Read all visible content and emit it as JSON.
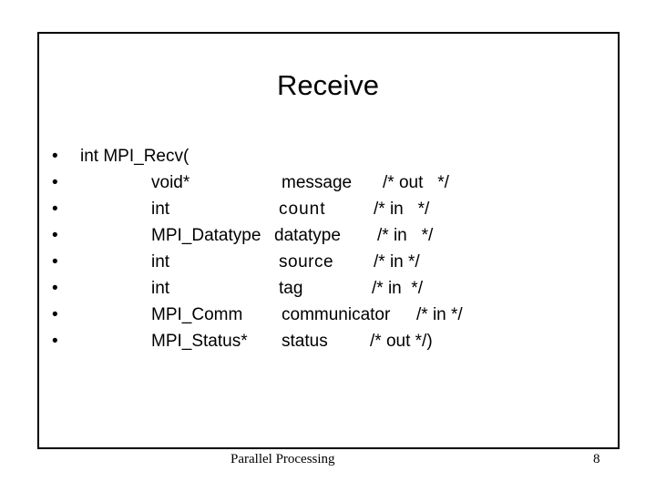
{
  "slide": {
    "title": "Receive",
    "lines": [
      {
        "bullet": "•",
        "head": "int MPI_Recv(",
        "type": "",
        "name": "",
        "comment": ""
      },
      {
        "bullet": "•",
        "head": "",
        "type": "void*",
        "name": "message",
        "comment": "/* out   */"
      },
      {
        "bullet": "•",
        "head": "",
        "type": "int",
        "name": "count",
        "comment": "/* in   */"
      },
      {
        "bullet": "•",
        "head": "",
        "type": "MPI_Datatype",
        "name": "datatype",
        "comment": "/* in   */"
      },
      {
        "bullet": "•",
        "head": "",
        "type": "int",
        "name": "source",
        "comment": "/* in */"
      },
      {
        "bullet": "•",
        "head": "",
        "type": "int",
        "name": "tag",
        "comment": "/* in  */"
      },
      {
        "bullet": "•",
        "head": "",
        "type": "MPI_Comm",
        "name": "communicator",
        "comment": "/* in */"
      },
      {
        "bullet": "•",
        "head": "",
        "type": "MPI_Status*",
        "name": "status",
        "comment": "/* out */)"
      }
    ],
    "footer_text": "Parallel Processing",
    "page_number": "8"
  }
}
